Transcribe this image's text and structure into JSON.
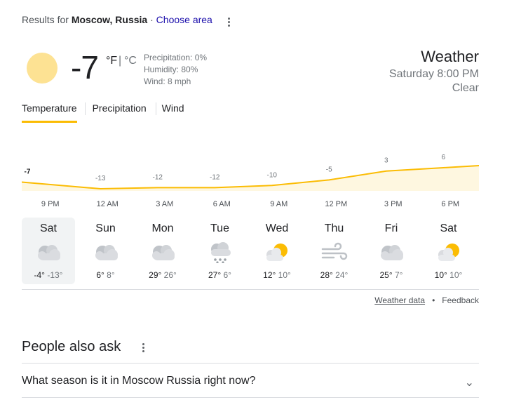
{
  "header": {
    "results_prefix": "Results for",
    "location": "Moscow, Russia",
    "separator": "·",
    "choose_area": "Choose area"
  },
  "current": {
    "temperature": "-7",
    "unit_f": "°F",
    "unit_sep": "|",
    "unit_c": "°C",
    "precipitation": "Precipitation: 0%",
    "humidity": "Humidity: 80%",
    "wind": "Wind: 8 mph",
    "title": "Weather",
    "datetime": "Saturday 8:00 PM",
    "condition": "Clear",
    "icon": "sun-icon"
  },
  "tabs": [
    "Temperature",
    "Precipitation",
    "Wind"
  ],
  "chart_data": {
    "type": "area",
    "x": [
      "9 PM",
      "12 AM",
      "3 AM",
      "6 AM",
      "9 AM",
      "12 PM",
      "3 PM",
      "6 PM"
    ],
    "values": [
      -7,
      -13,
      -12,
      -12,
      -10,
      -5,
      3,
      6
    ],
    "title": "",
    "xlabel": "",
    "ylabel": "",
    "color": "#fbbc04",
    "fill": "#fef7e0"
  },
  "forecast": [
    {
      "day": "Sat",
      "high": "-4°",
      "low": "-13°",
      "icon": "cloudy-icon",
      "selected": true
    },
    {
      "day": "Sun",
      "high": "6°",
      "low": "8°",
      "icon": "cloudy-icon"
    },
    {
      "day": "Mon",
      "high": "29°",
      "low": "26°",
      "icon": "cloudy-icon"
    },
    {
      "day": "Tue",
      "high": "27°",
      "low": "6°",
      "icon": "snow-icon"
    },
    {
      "day": "Wed",
      "high": "12°",
      "low": "10°",
      "icon": "partly-cloudy-icon"
    },
    {
      "day": "Thu",
      "high": "28°",
      "low": "24°",
      "icon": "wind-icon"
    },
    {
      "day": "Fri",
      "high": "25°",
      "low": "7°",
      "icon": "cloudy-icon"
    },
    {
      "day": "Sat",
      "high": "10°",
      "low": "10°",
      "icon": "partly-cloudy-icon"
    }
  ],
  "footer": {
    "weather_data": "Weather data",
    "dot": "•",
    "feedback": "Feedback"
  },
  "people_also_ask": {
    "title": "People also ask",
    "questions": [
      "What season is it in Moscow Russia right now?"
    ]
  }
}
